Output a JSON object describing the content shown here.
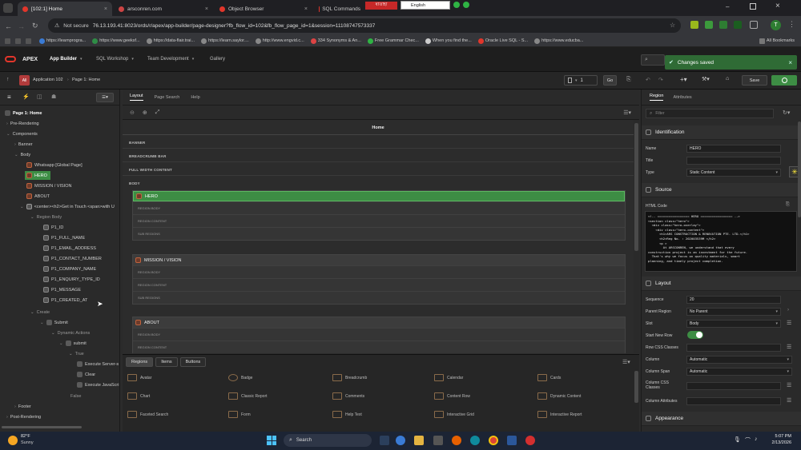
{
  "browser": {
    "tabs": [
      {
        "title": "[102:1] Home",
        "active": true
      },
      {
        "title": "arsconren.com",
        "active": false
      },
      {
        "title": "Object Browser",
        "active": false
      },
      {
        "title": "SQL Commands",
        "active": false
      }
    ],
    "tab_extra": "ষাতাহা",
    "language_select": "English",
    "security_label": "Not secure",
    "url": "76.13.193.41:8023/ords/r/apex/app-builder/page-designer?fb_flow_id=102&fb_flow_page_id=1&session=11108747573337",
    "bookmarks": [
      "https://learnprogra...",
      "https://www.geeksf...",
      "https://data-flair.trai...",
      "https://learn.saylor....",
      "http://www.engvid.c...",
      "334 Synonyms & An...",
      "Free Grammar Chec...",
      "When you find the...",
      "Oracle Live SQL - S...",
      "https://www.educba..."
    ],
    "all_bookmarks": "All Bookmarks",
    "profile_letter": "T"
  },
  "apex_nav": {
    "logo": "APEX",
    "menus": [
      "App Builder",
      "SQL Workshop",
      "Team Development",
      "Gallery"
    ],
    "notification": "Changes saved"
  },
  "page_toolbar": {
    "app_badge": "All",
    "app_name": "Application 102",
    "page_name": "Page 1: Home",
    "page_number": "1",
    "go_label": "Go",
    "save_label": "Save"
  },
  "tree": {
    "root": "Page 1: Home",
    "nodes": {
      "pre_rendering": "Pre-Rendering",
      "components": "Components",
      "banner": "Banner",
      "body": "Body",
      "whatsapp": "Whatsapp [Global Page]",
      "hero": "HERO",
      "mission": "MISSION / VISION",
      "about": "ABOUT",
      "contact": "<center><h2>Get in Touch <span>with U",
      "region_body": "Region Body",
      "items": [
        "P1_ID",
        "P1_FULL_NAME",
        "P1_EMAIL_ADDRESS",
        "P1_CONTACT_NUMBER",
        "P1_COMPANY_NAME",
        "P1_ENQUIRY_TYPE_ID",
        "P1_MESSAGE",
        "P1_CREATED_AT"
      ],
      "create": "Create",
      "submit": "Submit",
      "dynamic_actions": "Dynamic Actions",
      "submit_da": "submit",
      "true": "True",
      "actions": [
        "Execute Server-s",
        "Clear",
        "Execute JavaScri"
      ],
      "false": "False",
      "footer": "Footer",
      "post_rendering": "Post-Rendering"
    }
  },
  "layout": {
    "tabs": [
      "Layout",
      "Page Search",
      "Help"
    ],
    "page_title": "Home",
    "slots": [
      "BANNER",
      "BREADCRUMB BAR",
      "FULL WIDTH CONTENT",
      "BODY"
    ],
    "regions": [
      "HERO",
      "MISSION / VISION",
      "ABOUT"
    ],
    "sub_labels": [
      "REGION BODY",
      "REGION CONTENT",
      "SUB REGIONS"
    ]
  },
  "gallery": {
    "tabs": [
      "Regions",
      "Items",
      "Buttons"
    ],
    "items": [
      "Avatar",
      "Badge",
      "Breadcrumb",
      "Calendar",
      "Cards",
      "Chart",
      "Classic Report",
      "Comments",
      "Content Row",
      "Dynamic Content",
      "Faceted Search",
      "Form",
      "Help Text",
      "Interactive Grid",
      "Interactive Report"
    ]
  },
  "properties": {
    "tabs": [
      "Region",
      "Attributes"
    ],
    "filter_placeholder": "Filter",
    "sections": {
      "identification": "Identification",
      "source": "Source",
      "layout": "Layout",
      "appearance": "Appearance"
    },
    "name_label": "Name",
    "name_value": "HERO",
    "title_label": "Title",
    "title_value": "",
    "type_label": "Type",
    "type_value": "Static Content",
    "html_code_label": "HTML Code",
    "html_code": "<!-- ================= HERO ================= -->\n<section class=\"hero\">\n  <div class=\"hero-overlay\">\n    <div class=\"hero-content\">\n      <h1>ARS CONSTRUCTION & RENOVATION PTE. LTD.</h1>\n      <h2>Reg No. : 202003539M </h2>\n      <p >\n        At ARSCONREN, we understand that every\nconstruction project is an investment for the future.\n  That's why we focus on quality materials, smart\nplanning, and timely project completion.",
    "sequence_label": "Sequence",
    "sequence_value": "20",
    "parent_region_label": "Parent Region",
    "parent_region_value": "No Parent",
    "slot_label": "Slot",
    "slot_value": "Body",
    "start_new_row_label": "Start New Row",
    "row_css_label": "Row CSS Classes",
    "column_label": "Column",
    "column_value": "Automatic",
    "column_span_label": "Column Span",
    "column_span_value": "Automatic",
    "column_css_label": "Column CSS Classes",
    "column_attr_label": "Column Attributes"
  },
  "taskbar": {
    "weather_temp": "82°F",
    "weather_text": "Sunny",
    "search_label": "Search",
    "time": "5:07 PM",
    "date": "2/13/2026"
  },
  "colors": {
    "accent_green": "#3d8d44",
    "region_icon": "#c0633e",
    "apex_red": "#e2362b"
  }
}
